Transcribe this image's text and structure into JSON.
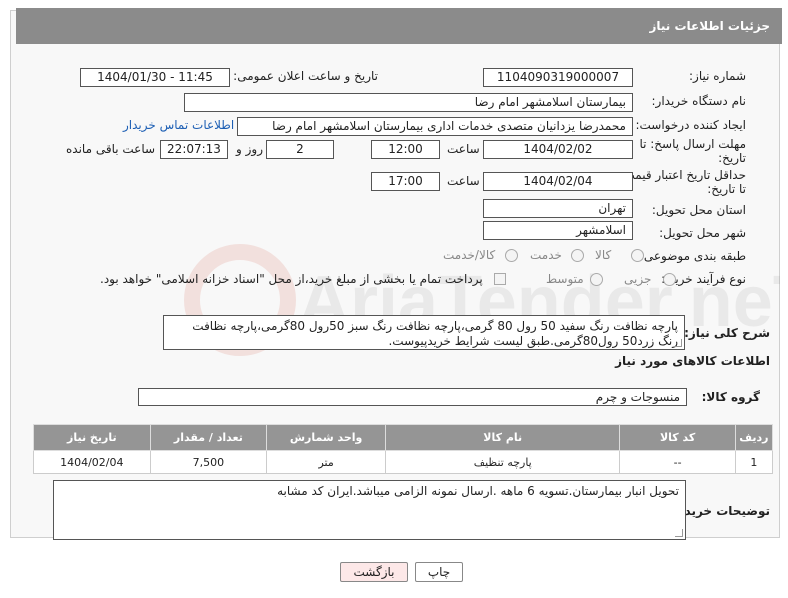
{
  "header": {
    "title": "جزئیات اطلاعات نیاز"
  },
  "fields": {
    "need_number_label": "شماره نیاز:",
    "need_number": "1104090319000007",
    "announce_label": "تاریخ و ساعت اعلان عمومی:",
    "announce_value": "1404/01/30 - 11:45",
    "buyer_org_label": "نام دستگاه خریدار:",
    "buyer_org": "بیمارستان اسلامشهر   امام رضا",
    "creator_label": "ایجاد کننده درخواست:",
    "creator": "محمدرضا یزدانیان متصدی خدمات اداری بیمارستان اسلامشهر   امام رضا",
    "contact_link": "اطلاعات تماس خریدار",
    "deadline_label": "مهلت ارسال پاسخ: تا تاریخ:",
    "deadline_date": "1404/02/02",
    "time_label": "ساعت",
    "deadline_time": "12:00",
    "days_value": "2",
    "days_label": "روز و",
    "remaining_time": "22:07:13",
    "remaining_label": "ساعت باقی مانده",
    "price_validity_label": "حداقل تاریخ اعتبار قیمت: تا تاریخ:",
    "price_date": "1404/02/04",
    "price_time": "17:00",
    "province_label": "استان محل تحویل:",
    "province": "تهران",
    "city_label": "شهر محل تحویل:",
    "city": "اسلامشهر",
    "category_label": "طبقه بندی موضوعی:",
    "category_options": [
      "کالا",
      "خدمت",
      "کالا/خدمت"
    ],
    "process_label": "نوع فرآیند خرید :",
    "process_options": [
      "جزیی",
      "متوسط"
    ],
    "payment_note": "پرداخت تمام یا بخشی از مبلغ خرید،از محل \"اسناد خزانه اسلامی\" خواهد بود."
  },
  "description": {
    "label": "شرح کلی نیاز:",
    "text": "پارچه نظافت رنگ سفید 50 رول 80 گرمی،پارچه نظافت رنگ سبز 50رول 80گرمی،پارچه نظافت رنگ زرد50 رول80گرمی.طبق لیست شرایط خریدپیوست."
  },
  "goods": {
    "section_title": "اطلاعات کالاهای مورد نیاز",
    "group_label": "گروه کالا:",
    "group_value": "منسوجات و چرم",
    "columns": [
      "ردیف",
      "کد کالا",
      "نام کالا",
      "واحد شمارش",
      "تعداد / مقدار",
      "تاریخ نیاز"
    ],
    "rows": [
      [
        "1",
        "--",
        "پارچه تنظیف",
        "متر",
        "7,500",
        "1404/02/04"
      ]
    ]
  },
  "buyer_notes": {
    "label": "توضیحات خریدار:",
    "text": "تحویل انبار بیمارستان.تسویه 6 ماهه .ارسال نمونه الزامی میباشد.ایران کد مشابه"
  },
  "buttons": {
    "print": "چاپ",
    "back": "بازگشت"
  },
  "watermark": {
    "text": "AriaTender.neT"
  },
  "colors": {
    "header_bg": "#8b8b8b",
    "table_header_bg": "#959595",
    "link": "#1d5fb4"
  }
}
